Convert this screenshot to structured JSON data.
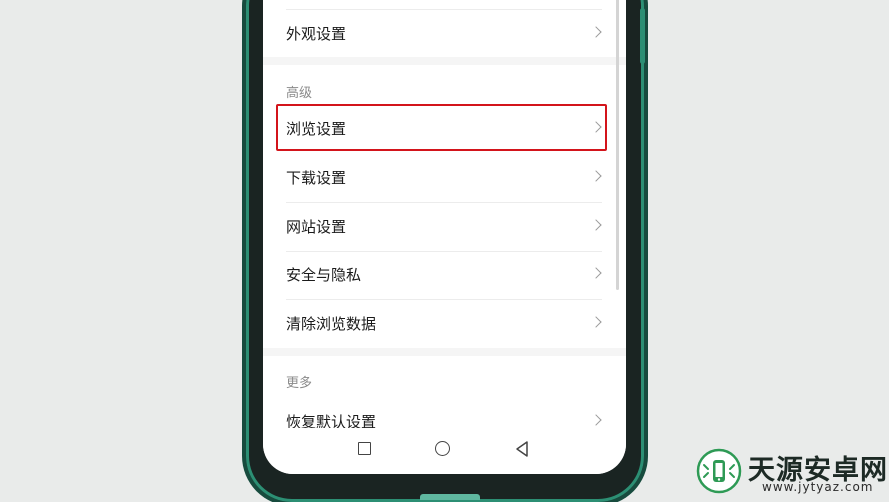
{
  "settings": {
    "appearance": {
      "label": "外观设置"
    },
    "advanced": {
      "header": "高级",
      "items": [
        {
          "label": "浏览设置",
          "highlighted": true
        },
        {
          "label": "下载设置"
        },
        {
          "label": "网站设置"
        },
        {
          "label": "安全与隐私"
        },
        {
          "label": "清除浏览数据"
        }
      ]
    },
    "more": {
      "header": "更多",
      "items": [
        {
          "label": "恢复默认设置"
        }
      ]
    }
  },
  "navbar": {
    "back_icon": "square-icon",
    "home_icon": "circle-icon",
    "recent_icon": "triangle-back-icon"
  },
  "watermark": {
    "name": "天源安卓网",
    "url": "www.jytyaz.com"
  },
  "colors": {
    "highlight": "#d3141b",
    "phone_frame": "#2c8f74",
    "background": "#e9ebea"
  }
}
